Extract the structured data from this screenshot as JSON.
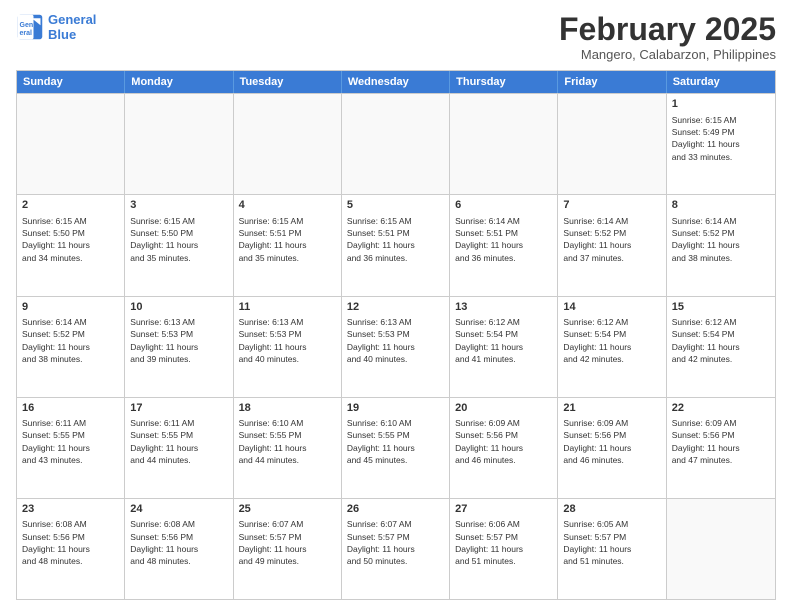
{
  "header": {
    "logo_line1": "General",
    "logo_line2": "Blue",
    "month_title": "February 2025",
    "location": "Mangero, Calabarzon, Philippines"
  },
  "days_of_week": [
    "Sunday",
    "Monday",
    "Tuesday",
    "Wednesday",
    "Thursday",
    "Friday",
    "Saturday"
  ],
  "weeks": [
    [
      {
        "day": "",
        "empty": true
      },
      {
        "day": "",
        "empty": true
      },
      {
        "day": "",
        "empty": true
      },
      {
        "day": "",
        "empty": true
      },
      {
        "day": "",
        "empty": true
      },
      {
        "day": "",
        "empty": true
      },
      {
        "day": "1",
        "text": "Sunrise: 6:15 AM\nSunset: 5:49 PM\nDaylight: 11 hours\nand 33 minutes."
      }
    ],
    [
      {
        "day": "2",
        "text": "Sunrise: 6:15 AM\nSunset: 5:50 PM\nDaylight: 11 hours\nand 34 minutes."
      },
      {
        "day": "3",
        "text": "Sunrise: 6:15 AM\nSunset: 5:50 PM\nDaylight: 11 hours\nand 35 minutes."
      },
      {
        "day": "4",
        "text": "Sunrise: 6:15 AM\nSunset: 5:51 PM\nDaylight: 11 hours\nand 35 minutes."
      },
      {
        "day": "5",
        "text": "Sunrise: 6:15 AM\nSunset: 5:51 PM\nDaylight: 11 hours\nand 36 minutes."
      },
      {
        "day": "6",
        "text": "Sunrise: 6:14 AM\nSunset: 5:51 PM\nDaylight: 11 hours\nand 36 minutes."
      },
      {
        "day": "7",
        "text": "Sunrise: 6:14 AM\nSunset: 5:52 PM\nDaylight: 11 hours\nand 37 minutes."
      },
      {
        "day": "8",
        "text": "Sunrise: 6:14 AM\nSunset: 5:52 PM\nDaylight: 11 hours\nand 38 minutes."
      }
    ],
    [
      {
        "day": "9",
        "text": "Sunrise: 6:14 AM\nSunset: 5:52 PM\nDaylight: 11 hours\nand 38 minutes."
      },
      {
        "day": "10",
        "text": "Sunrise: 6:13 AM\nSunset: 5:53 PM\nDaylight: 11 hours\nand 39 minutes."
      },
      {
        "day": "11",
        "text": "Sunrise: 6:13 AM\nSunset: 5:53 PM\nDaylight: 11 hours\nand 40 minutes."
      },
      {
        "day": "12",
        "text": "Sunrise: 6:13 AM\nSunset: 5:53 PM\nDaylight: 11 hours\nand 40 minutes."
      },
      {
        "day": "13",
        "text": "Sunrise: 6:12 AM\nSunset: 5:54 PM\nDaylight: 11 hours\nand 41 minutes."
      },
      {
        "day": "14",
        "text": "Sunrise: 6:12 AM\nSunset: 5:54 PM\nDaylight: 11 hours\nand 42 minutes."
      },
      {
        "day": "15",
        "text": "Sunrise: 6:12 AM\nSunset: 5:54 PM\nDaylight: 11 hours\nand 42 minutes."
      }
    ],
    [
      {
        "day": "16",
        "text": "Sunrise: 6:11 AM\nSunset: 5:55 PM\nDaylight: 11 hours\nand 43 minutes."
      },
      {
        "day": "17",
        "text": "Sunrise: 6:11 AM\nSunset: 5:55 PM\nDaylight: 11 hours\nand 44 minutes."
      },
      {
        "day": "18",
        "text": "Sunrise: 6:10 AM\nSunset: 5:55 PM\nDaylight: 11 hours\nand 44 minutes."
      },
      {
        "day": "19",
        "text": "Sunrise: 6:10 AM\nSunset: 5:55 PM\nDaylight: 11 hours\nand 45 minutes."
      },
      {
        "day": "20",
        "text": "Sunrise: 6:09 AM\nSunset: 5:56 PM\nDaylight: 11 hours\nand 46 minutes."
      },
      {
        "day": "21",
        "text": "Sunrise: 6:09 AM\nSunset: 5:56 PM\nDaylight: 11 hours\nand 46 minutes."
      },
      {
        "day": "22",
        "text": "Sunrise: 6:09 AM\nSunset: 5:56 PM\nDaylight: 11 hours\nand 47 minutes."
      }
    ],
    [
      {
        "day": "23",
        "text": "Sunrise: 6:08 AM\nSunset: 5:56 PM\nDaylight: 11 hours\nand 48 minutes."
      },
      {
        "day": "24",
        "text": "Sunrise: 6:08 AM\nSunset: 5:56 PM\nDaylight: 11 hours\nand 48 minutes."
      },
      {
        "day": "25",
        "text": "Sunrise: 6:07 AM\nSunset: 5:57 PM\nDaylight: 11 hours\nand 49 minutes."
      },
      {
        "day": "26",
        "text": "Sunrise: 6:07 AM\nSunset: 5:57 PM\nDaylight: 11 hours\nand 50 minutes."
      },
      {
        "day": "27",
        "text": "Sunrise: 6:06 AM\nSunset: 5:57 PM\nDaylight: 11 hours\nand 51 minutes."
      },
      {
        "day": "28",
        "text": "Sunrise: 6:05 AM\nSunset: 5:57 PM\nDaylight: 11 hours\nand 51 minutes."
      },
      {
        "day": "",
        "empty": true
      }
    ]
  ]
}
